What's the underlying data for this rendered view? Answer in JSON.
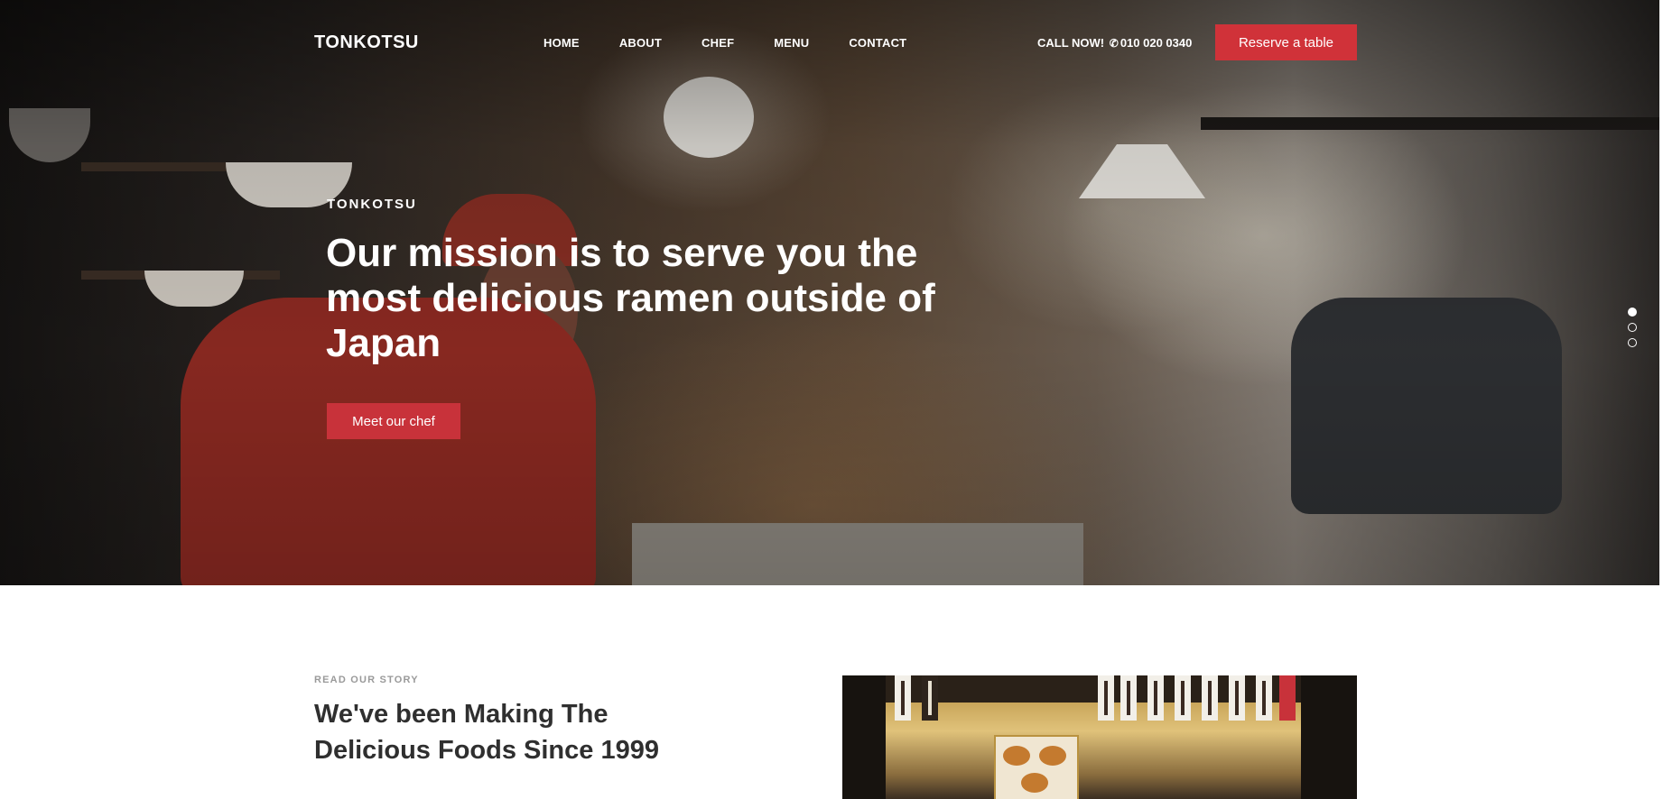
{
  "nav": {
    "brand": "TONKOTSU",
    "items": [
      "HOME",
      "ABOUT",
      "CHEF",
      "MENU",
      "CONTACT"
    ],
    "call_label": "CALL NOW!",
    "phone": "010 020 0340",
    "reserve_label": "Reserve a table"
  },
  "hero": {
    "eyebrow": "TONKOTSU",
    "title": "Our mission is to serve you the most delicious ramen outside of Japan",
    "cta_label": "Meet our chef",
    "slides": 3,
    "active_slide": 1
  },
  "story": {
    "eyebrow": "READ OUR STORY",
    "title": "We've been Making The Delicious Foods Since 1999"
  },
  "colors": {
    "accent": "#d03239",
    "heading": "#2f2f2f",
    "muted": "#9a9a9a"
  },
  "icons": {
    "phone": "phone-icon"
  }
}
